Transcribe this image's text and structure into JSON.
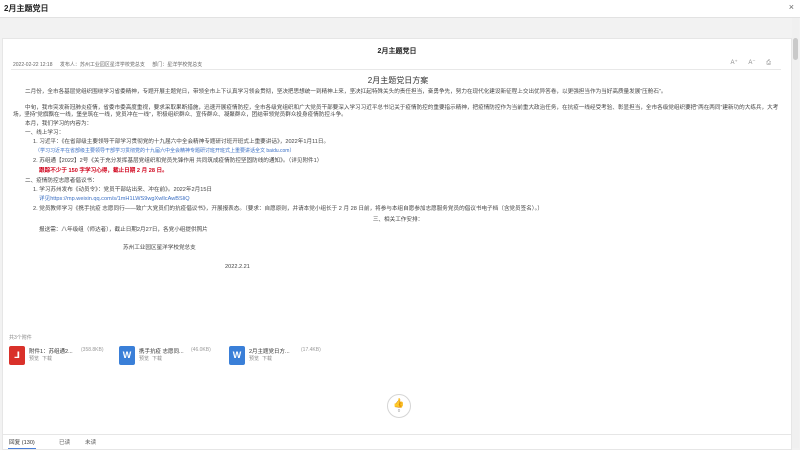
{
  "window": {
    "title": "2月主题党日",
    "close_label": "×"
  },
  "document": {
    "title": "2月主题党日",
    "meta": {
      "date": "2022-02-22 12:18",
      "publisher": "发布人：苏州工业园区星洋学校党总支",
      "department": "部门：星洋学校党总支"
    },
    "tools": [
      "A⁺",
      "A⁻",
      "⎙"
    ],
    "heading": "2月主题党日方案",
    "lines": [
      "二月份，全市各基层党组织围绕学习省委精神，专题开展主题党日，带领全市上下认真学习领会贯彻，坚决把思想统一到精神上来，坚决扛起特殊关头的责任担当，奋勇争先，努力在现代化建设新征程上交出优异答卷，以更强担当作为当好高质量发展“压舱石”。",
      "中旬，我市突发新冠肺炎疫情，省委市委高度重视，要求采取果断措施，迅速开展疫情防控，全市各级党组织和广大党员干部要深入学习习近平总书记关于疫情防控的重要指示精神，把疫情防控作为当前重大政治任务，在抗疫一线经受考验、彰显担当，全市各级党组织要把“两在两同”建新功的大练兵，大考场，坚持“党旗飘在一线，堡垒筑在一线，党员冲在一线”，积极组织群众、宣传群众、凝聚群众，团结带领党员群众投身疫情防控斗争。",
      "本月，我们学习的内容为：",
      "一、线上学习：",
      "1. 习近平：《在省部级主要领导干部学习贯彻党的十九届六中全会精神专题研讨班开班式上重要讲话》，2022年1月11日。",
      "（学习习近平在省部级主要领导干部学习贯彻党的十九届六中全会精神专题研讨班开班式上重要讲话全文 baidu.com）",
      "2. 苏组通【2022】2号《关于充分发挥基层党组织和党员先锋作用 共同筑成疫情防控坚固防线的通知》。（详见附件1）",
      "跟踪不少于 150 字学习心得，截止日期 2 月 28 日。",
      "二、疫情防控志愿者倡议书：",
      "1. 学习苏州发布《动员令》：党员干部站出来、冲在前》。2022年2月15日",
      "详见https://mp.weixin.qq.com/s/1mH1LWS9wgXwllcAwBSliQ",
      "2. 党员教师学习《携手抗疫 志愿同行——致广大党员们的抗疫倡议书》，开展报表态。（要求：自愿原则，并请本党小组长于 2 月 28 日前，将参与本组自愿参加志愿服务党员的倡议书电子档（含党员签名）。）",
      "三、相关工作安排：",
      "报送需：八年级组（师达者），截止日期2月27日，各党小组提供照片",
      "苏州工业园区星洋学校党总支",
      "2022.2.21"
    ]
  },
  "attachments": {
    "label": "共3个附件",
    "items": [
      {
        "icon": "pdf-icon",
        "name": "附件1：苏组通2...",
        "size": "(358.8KB)",
        "actions": [
          "预览",
          "下载"
        ]
      },
      {
        "icon": "word-icon",
        "name": "携手抗疫 志愿同...",
        "size": "(46.0KB)",
        "actions": [
          "预览",
          "下载"
        ]
      },
      {
        "icon": "word-icon",
        "name": "2月主题党日方...",
        "size": "(17.4KB)",
        "actions": [
          "预览",
          "下载"
        ]
      }
    ]
  },
  "like": {
    "glyph": "👍",
    "count": "0"
  },
  "tabs": [
    "回复 (130)",
    "已读",
    "未读"
  ]
}
